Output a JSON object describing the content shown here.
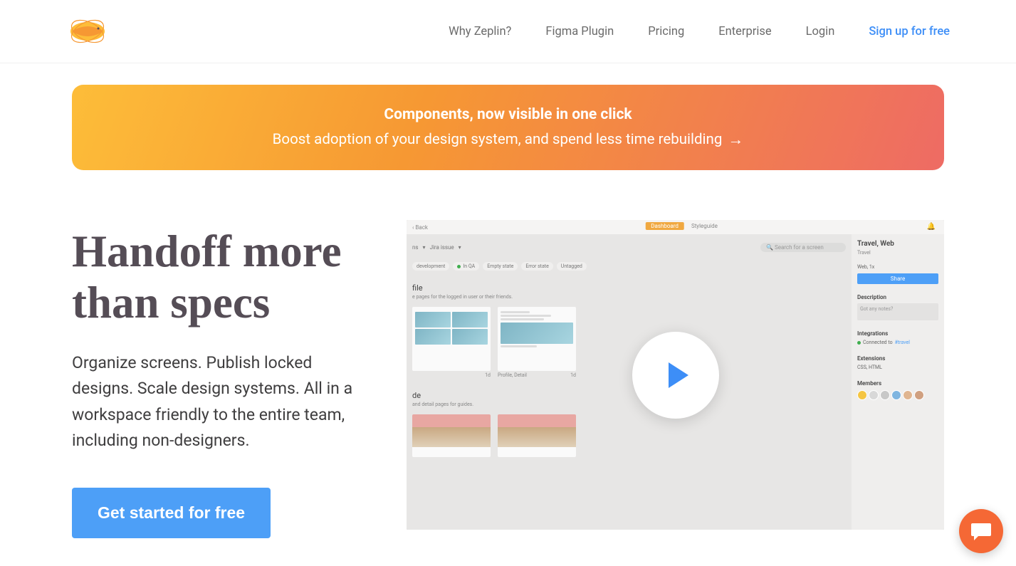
{
  "nav": {
    "why": "Why Zeplin?",
    "figma": "Figma Plugin",
    "pricing": "Pricing",
    "enterprise": "Enterprise",
    "login": "Login",
    "signup": "Sign up for free"
  },
  "banner": {
    "title": "Components, now visible in one click",
    "subtitle": "Boost adoption of your design system, and spend less time rebuilding"
  },
  "hero": {
    "title": "Handoff more than specs",
    "description": "Organize screens. Publish locked designs. Scale design systems. All in a workspace friendly to the entire team, including non-designers.",
    "cta": "Get started for free"
  },
  "preview": {
    "back": "Back",
    "tabs": {
      "dashboard": "Dashboard",
      "styleguide": "Styleguide"
    },
    "toolbar": {
      "ns": "ns",
      "jira": "Jira issue",
      "search": "Search for a screen"
    },
    "chips": {
      "dev": "development",
      "qa": "In QA",
      "empty": "Empty state",
      "error": "Error state",
      "untagged": "Untagged"
    },
    "section1": {
      "title": "file",
      "sub": "e pages for the logged in user or their friends."
    },
    "card1_label": "1d",
    "card2_title": "Profile, Detail",
    "card2_label": "1d",
    "section2": {
      "title": "de",
      "sub": "and detail pages for guides."
    },
    "sidebar": {
      "title": "Travel, Web",
      "sub": "Travel",
      "platform": "Web, 1x",
      "share": "Share",
      "description_label": "Description",
      "notes_placeholder": "Got any notes?",
      "integrations_label": "Integrations",
      "connected": "Connected to",
      "channel": "#travel",
      "extensions_label": "Extensions",
      "extensions": "CSS, HTML",
      "members_label": "Members"
    }
  }
}
